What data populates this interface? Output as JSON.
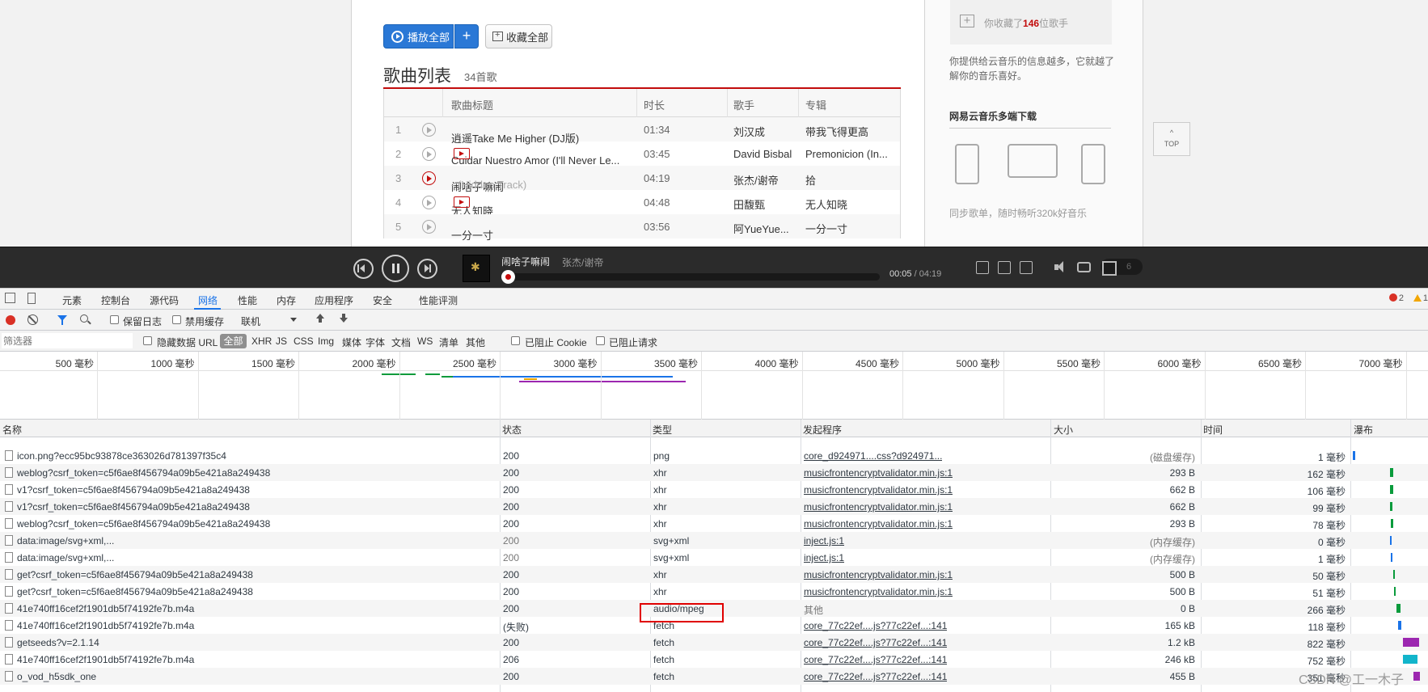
{
  "web": {
    "play_all": "播放全部",
    "add": "+",
    "fav_all": "收藏全部",
    "list_title": "歌曲列表",
    "list_count": "34首歌",
    "cols": [
      "歌曲标题",
      "时长",
      "歌手",
      "专辑"
    ],
    "songs": [
      {
        "idx": "1",
        "title": "逍遥Take Me Higher (DJ版)",
        "sub": "",
        "mv": false,
        "duration": "01:34",
        "artist": "刘汉成",
        "album": "带我飞得更高"
      },
      {
        "idx": "2",
        "title": "Cuidar Nuestro Amor (I'll Never Le...",
        "sub": "",
        "mv": true,
        "duration": "03:45",
        "artist": "David Bisbal",
        "album": "Premonicion (In..."
      },
      {
        "idx": "3",
        "title": "闹啥子嘛闹",
        "sub": " - (Hidden Track)",
        "mv": false,
        "duration": "04:19",
        "artist": "张杰/谢帝",
        "album": "拾"
      },
      {
        "idx": "4",
        "title": "无人知晓",
        "sub": "",
        "mv": true,
        "duration": "04:48",
        "artist": "田馥甄",
        "album": "无人知晓"
      },
      {
        "idx": "5",
        "title": "一分一寸",
        "sub": "",
        "mv": false,
        "duration": "03:56",
        "artist": "阿YueYue...",
        "album": "一分一寸"
      }
    ],
    "right": {
      "fav_prefix": "你收藏了",
      "fav_count": "146",
      "fav_suffix": "位歌手",
      "info": "你提供给云音乐的信息越多，它就越了解你的音乐喜好。",
      "download_title": "网易云音乐多端下载",
      "sync": "同步歌单，随时畅听320k好音乐",
      "top": "TOP"
    }
  },
  "player": {
    "song": "闹啥子嘛闹",
    "artist": "张杰/谢帝",
    "current": "00:05",
    "total": "/ 04:19",
    "progress": 0.02,
    "playlist_count": "6"
  },
  "devtools": {
    "tabs": [
      "元素",
      "控制台",
      "源代码",
      "网络",
      "性能",
      "内存",
      "应用程序",
      "安全",
      "性能评测"
    ],
    "active_tab": "网络",
    "errors": "2",
    "warnings": "1",
    "toolbar": {
      "preserve_log": "保留日志",
      "disable_cache": "禁用缓存",
      "throttle": "联机"
    },
    "filter": {
      "placeholder": "筛选器",
      "hide_data_urls": "隐藏数据 URL",
      "all": "全部",
      "types": [
        "XHR",
        "JS",
        "CSS",
        "Img",
        "媒体",
        "字体",
        "文档",
        "WS",
        "清单",
        "其他"
      ],
      "blocked_cookies": "已阻止 Cookie",
      "blocked_requests": "已阻止请求"
    },
    "overview_ticks": [
      "500 毫秒",
      "1000 毫秒",
      "1500 毫秒",
      "2000 毫秒",
      "2500 毫秒",
      "3000 毫秒",
      "3500 毫秒",
      "4000 毫秒",
      "4500 毫秒",
      "5000 毫秒",
      "5500 毫秒",
      "6000 毫秒",
      "6500 毫秒",
      "7000 毫秒"
    ],
    "columns": [
      "名称",
      "状态",
      "类型",
      "发起程序",
      "大小",
      "时间",
      "瀑布"
    ],
    "rows": [
      {
        "name": "icon.png?ecc95bc93878ce363026d781397f35c4",
        "status": "200",
        "type": "png",
        "initiator": "core_d924971....css?d924971...",
        "size": "(磁盘缓存)",
        "time": "1 毫秒"
      },
      {
        "name": "weblog?csrf_token=c5f6ae8f456794a09b5e421a8a249438",
        "status": "200",
        "type": "xhr",
        "initiator": "musicfrontencryptvalidator.min.js:1",
        "size": "293 B",
        "time": "162 毫秒"
      },
      {
        "name": "v1?csrf_token=c5f6ae8f456794a09b5e421a8a249438",
        "status": "200",
        "type": "xhr",
        "initiator": "musicfrontencryptvalidator.min.js:1",
        "size": "662 B",
        "time": "106 毫秒"
      },
      {
        "name": "v1?csrf_token=c5f6ae8f456794a09b5e421a8a249438",
        "status": "200",
        "type": "xhr",
        "initiator": "musicfrontencryptvalidator.min.js:1",
        "size": "662 B",
        "time": "99 毫秒"
      },
      {
        "name": "weblog?csrf_token=c5f6ae8f456794a09b5e421a8a249438",
        "status": "200",
        "type": "xhr",
        "initiator": "musicfrontencryptvalidator.min.js:1",
        "size": "293 B",
        "time": "78 毫秒"
      },
      {
        "name": "data:image/svg+xml,...",
        "status": "200",
        "type": "svg+xml",
        "initiator": "inject.js:1",
        "size": "(内存缓存)",
        "time": "0 毫秒"
      },
      {
        "name": "data:image/svg+xml,...",
        "status": "200",
        "type": "svg+xml",
        "initiator": "inject.js:1",
        "size": "(内存缓存)",
        "time": "1 毫秒"
      },
      {
        "name": "get?csrf_token=c5f6ae8f456794a09b5e421a8a249438",
        "status": "200",
        "type": "xhr",
        "initiator": "musicfrontencryptvalidator.min.js:1",
        "size": "500 B",
        "time": "50 毫秒"
      },
      {
        "name": "get?csrf_token=c5f6ae8f456794a09b5e421a8a249438",
        "status": "200",
        "type": "xhr",
        "initiator": "musicfrontencryptvalidator.min.js:1",
        "size": "500 B",
        "time": "51 毫秒"
      },
      {
        "name": "41e740ff16cef2f1901db5f74192fe7b.m4a",
        "status": "200",
        "type": "audio/mpeg",
        "initiator": "其他",
        "size": "0 B",
        "time": "266 毫秒"
      },
      {
        "name": "41e740ff16cef2f1901db5f74192fe7b.m4a",
        "status": "(失败)",
        "type": "fetch",
        "initiator": "core_77c22ef....js?77c22ef...:141",
        "size": "165 kB",
        "time": "118 毫秒"
      },
      {
        "name": "getseeds?v=2.1.14",
        "status": "200",
        "type": "fetch",
        "initiator": "core_77c22ef....js?77c22ef...:141",
        "size": "1.2 kB",
        "time": "822 毫秒"
      },
      {
        "name": "41e740ff16cef2f1901db5f74192fe7b.m4a",
        "status": "206",
        "type": "fetch",
        "initiator": "core_77c22ef....js?77c22ef...:141",
        "size": "246 kB",
        "time": "752 毫秒"
      },
      {
        "name": "o_vod_h5sdk_one",
        "status": "200",
        "type": "fetch",
        "initiator": "core_77c22ef....js?77c22ef...:141",
        "size": "455 B",
        "time": "351 毫秒"
      }
    ],
    "watermark": "CSDN @工一木子"
  }
}
